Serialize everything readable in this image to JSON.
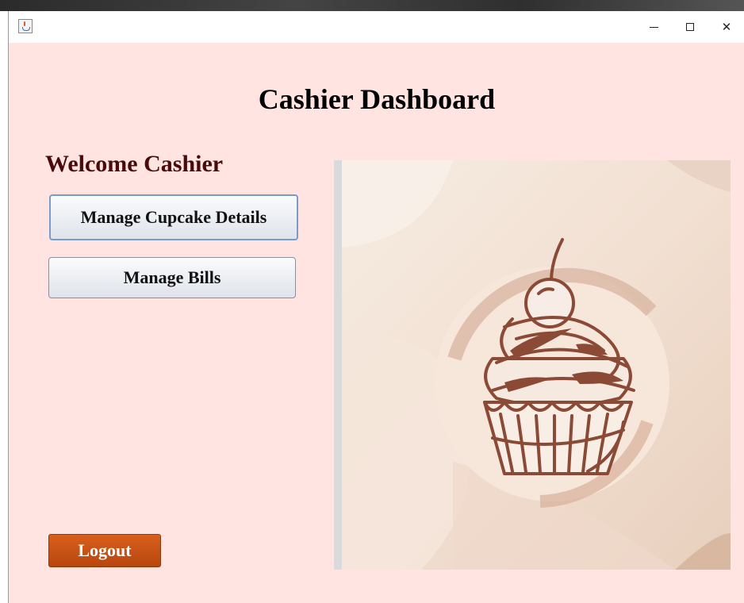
{
  "window": {
    "app_icon": "java-coffee-icon",
    "minimize_icon": "minimize-icon",
    "maximize_icon": "maximize-icon",
    "close_icon": "close-icon"
  },
  "main": {
    "title": "Cashier Dashboard",
    "welcome": "Welcome Cashier",
    "buttons": {
      "manage_cupcake": "Manage Cupcake Details",
      "manage_bills": "Manage Bills",
      "logout": "Logout"
    },
    "image_icon": "cupcake-illustration"
  },
  "colors": {
    "background": "#ffe4e2",
    "welcome_text": "#4a0a0a",
    "logout_button": "#c9521a",
    "cupcake_stroke": "#8b4a36"
  }
}
